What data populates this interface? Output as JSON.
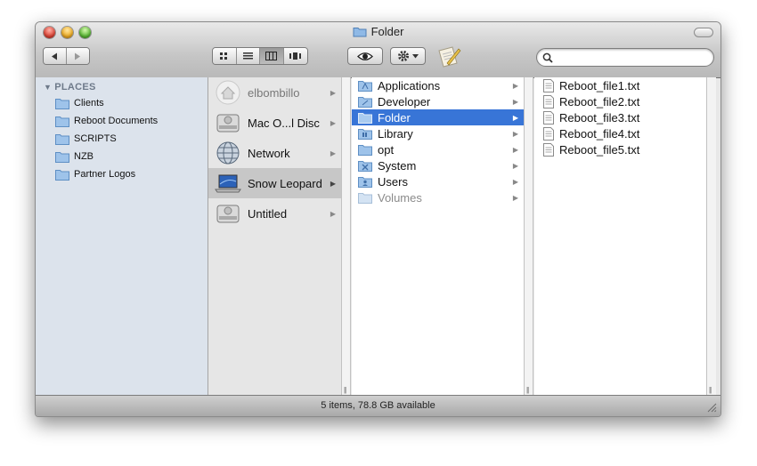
{
  "window": {
    "title": "Folder"
  },
  "toolbar": {
    "view_buttons": [
      "icon-view",
      "list-view",
      "column-view",
      "coverflow-view"
    ],
    "active_view": "column-view",
    "search": {
      "placeholder": "",
      "value": ""
    }
  },
  "sidebar": {
    "header": "PLACES",
    "items": [
      {
        "label": "Clients"
      },
      {
        "label": "Reboot Documents"
      },
      {
        "label": "SCRIPTS"
      },
      {
        "label": "NZB"
      },
      {
        "label": "Partner Logos"
      }
    ]
  },
  "devices": [
    {
      "label": "elbombillo",
      "icon": "home-network-icon",
      "dim": true
    },
    {
      "label": "Mac O...l Disc",
      "icon": "disk-icon"
    },
    {
      "label": "Network",
      "icon": "network-globe-icon"
    },
    {
      "label": "Snow Leopard",
      "icon": "laptop-icon",
      "selected": true
    },
    {
      "label": "Untitled",
      "icon": "disk-icon"
    }
  ],
  "folders": [
    {
      "label": "Applications"
    },
    {
      "label": "Developer"
    },
    {
      "label": "Folder",
      "selected": true
    },
    {
      "label": "Library"
    },
    {
      "label": "opt"
    },
    {
      "label": "System"
    },
    {
      "label": "Users"
    },
    {
      "label": "Volumes",
      "dim": true
    }
  ],
  "files": [
    {
      "label": "Reboot_file1.txt"
    },
    {
      "label": "Reboot_file2.txt"
    },
    {
      "label": "Reboot_file3.txt"
    },
    {
      "label": "Reboot_file4.txt"
    },
    {
      "label": "Reboot_file5.txt"
    }
  ],
  "status": {
    "text": "5 items, 78.8 GB available"
  },
  "colors": {
    "selection": "#3875d7",
    "sidebar": "#dce3ec"
  }
}
